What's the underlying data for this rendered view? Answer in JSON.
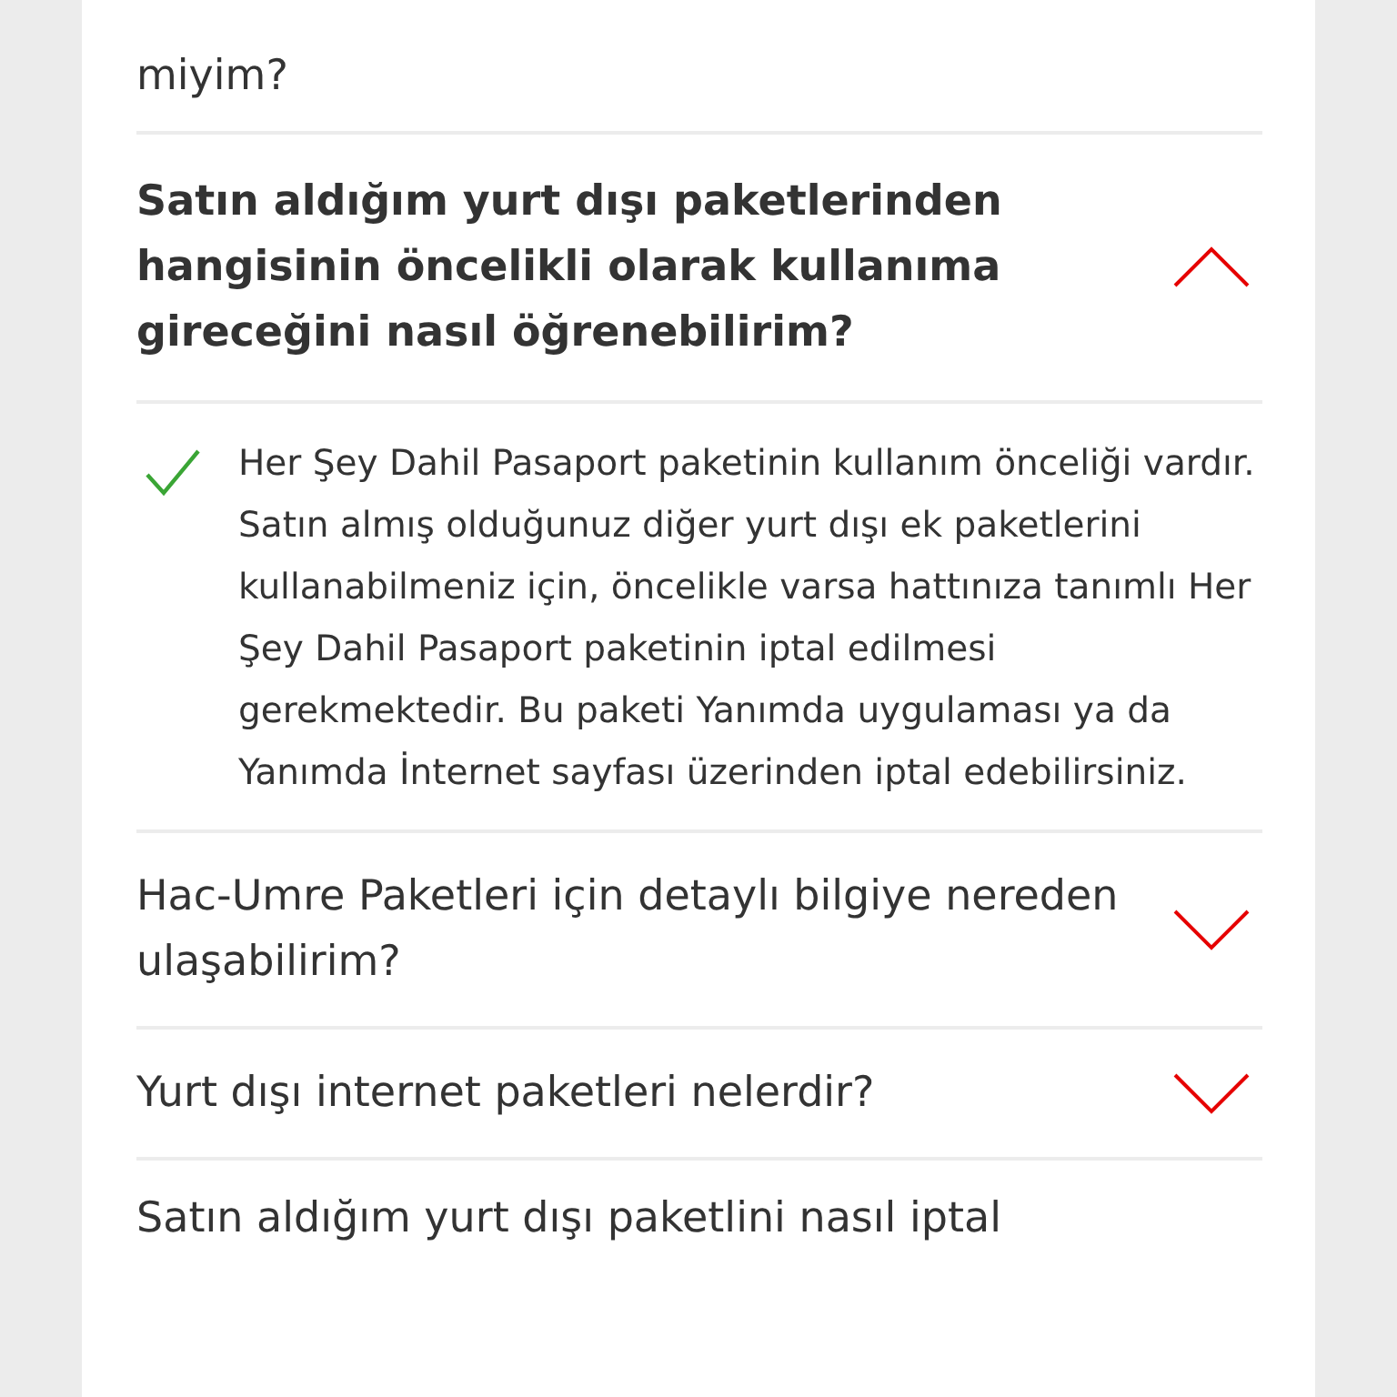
{
  "faq": [
    {
      "kind": "partial",
      "question": "miyim?"
    },
    {
      "kind": "question",
      "question": "Satın aldığım yurt dışı paketlerinden hangisinin öncelikli olarak kullanıma gireceğini nasıl öğrenebilirim?",
      "expanded": true,
      "answer": "Her Şey Dahil Pasaport paketinin kullanım önceliği vardır. Satın almış olduğunuz diğer yurt dışı ek paketlerini kullanabilmeniz için, öncelikle varsa hattınıza tanımlı Her Şey Dahil Pasaport paketinin iptal edilmesi gerekmektedir. Bu paketi Yanımda uygulaması ya da Yanımda İnternet sayfası üzerinden iptal edebilirsiniz."
    },
    {
      "kind": "question",
      "question": "Hac-Umre Paketleri için detaylı bilgiye nereden ulaşabilirim?",
      "expanded": false
    },
    {
      "kind": "question",
      "question": "Yurt dışı internet paketleri nelerdir?",
      "expanded": false
    },
    {
      "kind": "partial",
      "question": "Satın aldığım yurt dışı paketlini nasıl iptal"
    }
  ]
}
